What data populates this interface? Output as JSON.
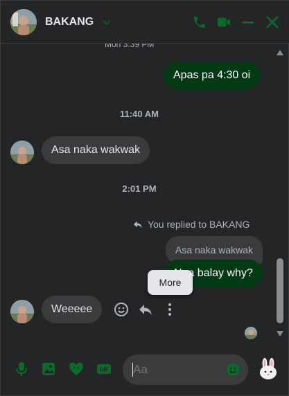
{
  "header": {
    "contact_name": "BAKANG",
    "icons": [
      "chevron-down-icon",
      "phone-icon",
      "video-icon",
      "minimize-icon",
      "close-icon"
    ]
  },
  "messages": {
    "cut_timestamp": "Mon 3:39 PM",
    "sent_1": "Apas pa 4:30 oi",
    "timestamp_1": "11:40 AM",
    "received_1": "Asa naka wakwak",
    "timestamp_2": "2:01 PM",
    "reply_notice": "You replied to BAKANG",
    "quoted_text": "Asa naka wakwak",
    "sent_2": "Naa balay why?",
    "received_2": "Weeeee",
    "tooltip": "More"
  },
  "composer": {
    "placeholder": "Aa",
    "icons": [
      "microphone-icon",
      "image-icon",
      "sticker-icon",
      "gif-icon",
      "emoji-icon"
    ]
  },
  "colors": {
    "background": "#242526",
    "outgoing_bubble": "#033a16",
    "incoming_bubble": "#3a3b3c",
    "accent_icon": "#0e7a2e"
  }
}
